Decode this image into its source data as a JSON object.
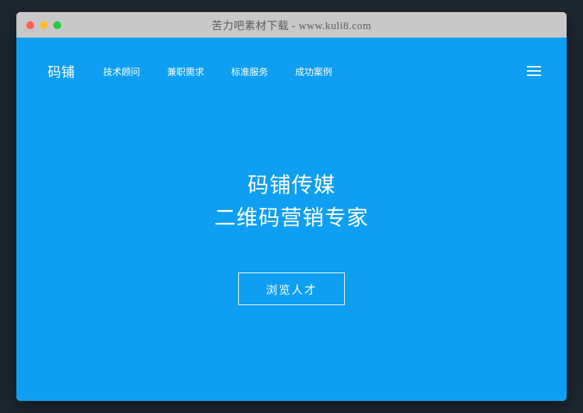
{
  "window": {
    "title": "苦力吧素材下载 - www.kuli8.com"
  },
  "navbar": {
    "logo": "码铺",
    "links": [
      "技术顾问",
      "兼职需求",
      "标准服务",
      "成功案例"
    ]
  },
  "hero": {
    "line1": "码铺传媒",
    "line2": "二维码营销专家",
    "cta": "浏览人才"
  }
}
